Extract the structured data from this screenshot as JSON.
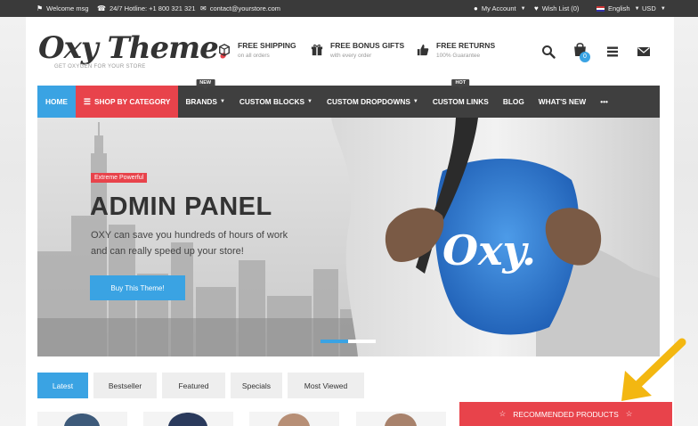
{
  "topbar": {
    "welcome": "Welcome msg",
    "hotline": "24/7 Hotline: +1 800 321 321",
    "email": "contact@yourstore.com",
    "account": "My Account",
    "wishlist": "Wish List (0)",
    "language": "English",
    "currency": "USD"
  },
  "header": {
    "logo_main": "Oxy Theme",
    "logo_dot": ".",
    "logo_tagline": "GET OXYGEN FOR YOUR STORE",
    "features": [
      {
        "title": "FREE SHIPPING",
        "sub": "on all orders",
        "icon": "box-icon"
      },
      {
        "title": "FREE BONUS GIFTS",
        "sub": "with every order",
        "icon": "gift-icon"
      },
      {
        "title": "FREE RETURNS",
        "sub": "100% Guarantee",
        "icon": "thumbs-up-icon"
      }
    ],
    "cart_count": "0"
  },
  "nav": {
    "items": [
      {
        "label": "HOME"
      },
      {
        "label": "SHOP BY CATEGORY"
      },
      {
        "label": "BRANDS",
        "badge": "NEW"
      },
      {
        "label": "CUSTOM BLOCKS"
      },
      {
        "label": "CUSTOM DROPDOWNS"
      },
      {
        "label": "CUSTOM LINKS",
        "badge": "HOT"
      },
      {
        "label": "BLOG"
      },
      {
        "label": "WHAT'S NEW"
      },
      {
        "label": "•••"
      }
    ]
  },
  "banner": {
    "tag": "Extreme Powerful",
    "title": "ADMIN PANEL",
    "text": "OXY can save you hundreds of hours of work and can really speed up your store!",
    "button": "Buy This Theme!",
    "shirt_logo": "Oxy."
  },
  "tabs": [
    "Latest",
    "Bestseller",
    "Featured",
    "Specials",
    "Most Viewed"
  ],
  "recommended": "RECOMMENDED PRODUCTS",
  "colors": {
    "accent_blue": "#3aa3e3",
    "accent_red": "#e8434b",
    "nav_bg": "#3f3f3f",
    "topbar_bg": "#3a3a3a",
    "annotation_arrow": "#f3b711"
  }
}
